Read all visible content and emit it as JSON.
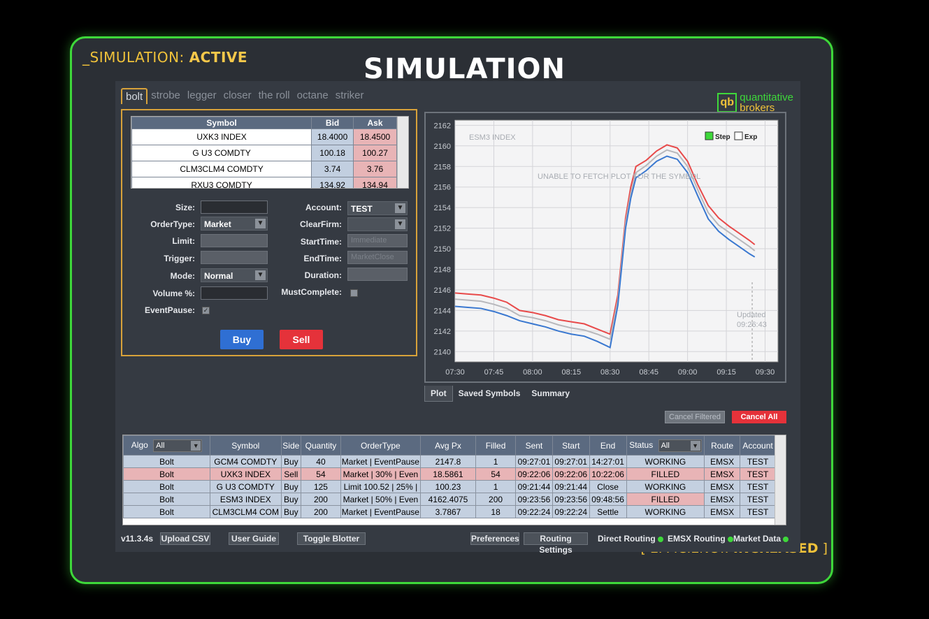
{
  "overlay": {
    "sim_status_prefix": "_SIMULATION: ",
    "sim_status_value": "ACTIVE",
    "title": "SIMULATION",
    "efficiency_prefix": "[ EFFICIENCY: ",
    "efficiency_value": "INCREASED",
    "efficiency_suffix": " ]"
  },
  "tabs": [
    "bolt",
    "strobe",
    "legger",
    "closer",
    "the roll",
    "octane",
    "striker"
  ],
  "logo": {
    "mark": "qb",
    "line1": "quantitative",
    "line2": "brokers"
  },
  "quotes": {
    "headers": [
      "Symbol",
      "Bid",
      "Ask"
    ],
    "rows": [
      {
        "symbol": "UXK3 INDEX",
        "bid": "18.4000",
        "ask": "18.4500"
      },
      {
        "symbol": "G U3 COMDTY",
        "bid": "100.18",
        "ask": "100.27"
      },
      {
        "symbol": "CLM3CLM4 COMDTY",
        "bid": "3.74",
        "ask": "3.76"
      },
      {
        "symbol": "RXU3 COMDTY",
        "bid": "134.92",
        "ask": "134.94"
      }
    ]
  },
  "form": {
    "size_label": "Size:",
    "ordertype_label": "OrderType:",
    "ordertype_value": "Market",
    "limit_label": "Limit:",
    "trigger_label": "Trigger:",
    "mode_label": "Mode:",
    "mode_value": "Normal",
    "volume_label": "Volume %:",
    "eventpause_label": "EventPause:",
    "account_label": "Account:",
    "account_value": "TEST",
    "clearfirm_label": "ClearFirm:",
    "starttime_label": "StartTime:",
    "starttime_placeholder": "Immediate",
    "endtime_label": "EndTime:",
    "endtime_placeholder": "MarketClose",
    "duration_label": "Duration:",
    "mustcomplete_label": "MustComplete:",
    "buy_label": "Buy",
    "sell_label": "Sell"
  },
  "chart_data": {
    "type": "line",
    "title": "ESM3 INDEX",
    "annotation": "UNABLE TO FETCH PLOT FOR THE SYMBOL",
    "updated_label": "Updated",
    "updated_time": "09:26:43",
    "legend": {
      "step": "Step",
      "exp": "Exp"
    },
    "xlabel": "",
    "ylabel": "",
    "x_ticks": [
      "07:30",
      "07:45",
      "08:00",
      "08:15",
      "08:30",
      "08:45",
      "09:00",
      "09:15",
      "09:30"
    ],
    "y_ticks": [
      2140,
      2142,
      2144,
      2146,
      2148,
      2150,
      2152,
      2154,
      2156,
      2158,
      2160,
      2162
    ],
    "ylim": [
      2139,
      2162.5
    ],
    "xlim_minutes": [
      450,
      575
    ],
    "x": [
      450,
      455,
      460,
      465,
      470,
      475,
      480,
      485,
      490,
      495,
      500,
      505,
      510,
      513,
      516,
      518,
      520,
      524,
      528,
      532,
      536,
      540,
      544,
      548,
      552,
      556,
      560,
      564,
      566
    ],
    "series": [
      {
        "color": "#e84a4a",
        "values": [
          2145.7,
          2145.6,
          2145.5,
          2145.2,
          2144.8,
          2144.0,
          2143.8,
          2143.5,
          2143.1,
          2142.9,
          2142.7,
          2142.2,
          2141.7,
          2145.5,
          2153.0,
          2156.0,
          2158.0,
          2158.6,
          2159.5,
          2160.1,
          2159.8,
          2158.5,
          2156.2,
          2154.2,
          2153.0,
          2152.2,
          2151.5,
          2150.8,
          2150.4
        ]
      },
      {
        "color": "#b8b8bc",
        "values": [
          2145.1,
          2145.0,
          2144.9,
          2144.6,
          2144.2,
          2143.5,
          2143.3,
          2143.0,
          2142.6,
          2142.3,
          2142.1,
          2141.7,
          2141.2,
          2145.0,
          2152.5,
          2155.4,
          2157.4,
          2158.1,
          2159.0,
          2159.6,
          2159.3,
          2158.0,
          2155.7,
          2153.5,
          2152.3,
          2151.6,
          2150.9,
          2150.2,
          2149.8
        ]
      },
      {
        "color": "#3a78d0",
        "values": [
          2144.4,
          2144.3,
          2144.2,
          2143.9,
          2143.5,
          2143.0,
          2142.7,
          2142.4,
          2142.0,
          2141.7,
          2141.5,
          2141.0,
          2140.4,
          2144.5,
          2152.0,
          2154.9,
          2156.9,
          2157.6,
          2158.5,
          2159.0,
          2158.7,
          2157.4,
          2155.1,
          2152.9,
          2151.7,
          2150.9,
          2150.2,
          2149.5,
          2149.2
        ]
      }
    ]
  },
  "chart_tabs": [
    "Plot",
    "Saved Symbols",
    "Summary"
  ],
  "actions": {
    "cancel_filtered": "Cancel Filtered",
    "cancel_all": "Cancel All"
  },
  "blotter": {
    "headers": [
      "Algo",
      "Symbol",
      "Side",
      "Quantity",
      "OrderType",
      "Avg Px",
      "Filled",
      "Sent",
      "Start",
      "End",
      "Status",
      "Route",
      "Account"
    ],
    "algo_filter": "All",
    "status_filter": "All",
    "rows": [
      [
        "Bolt",
        "GCM4 COMDTY",
        "Buy",
        "40",
        "Market | EventPause",
        "2147.8",
        "1",
        "09:27:01",
        "09:27:01",
        "14:27:01",
        "WORKING",
        "EMSX",
        "TEST"
      ],
      [
        "Bolt",
        "UXK3 INDEX",
        "Sell",
        "54",
        "Market | 30% | Even",
        "18.5861",
        "54",
        "09:22:06",
        "09:22:06",
        "10:22:06",
        "FILLED",
        "EMSX",
        "TEST"
      ],
      [
        "Bolt",
        "G U3 COMDTY",
        "Buy",
        "125",
        "Limit 100.52 | 25% |",
        "100.23",
        "1",
        "09:21:44",
        "09:21:44",
        "Close",
        "WORKING",
        "EMSX",
        "TEST"
      ],
      [
        "Bolt",
        "ESM3 INDEX",
        "Buy",
        "200",
        "Market | 50% | Even",
        "4162.4075",
        "200",
        "09:23:56",
        "09:23:56",
        "09:48:56",
        "FILLED",
        "EMSX",
        "TEST"
      ],
      [
        "Bolt",
        "CLM3CLM4 COM",
        "Buy",
        "200",
        "Market | EventPause",
        "3.7867",
        "18",
        "09:22:24",
        "09:22:24",
        "Settle",
        "WORKING",
        "EMSX",
        "TEST"
      ]
    ]
  },
  "footer": {
    "version": "v11.3.4s",
    "upload_csv": "Upload CSV",
    "user_guide": "User Guide",
    "toggle_blotter": "Toggle Blotter",
    "preferences": "Preferences",
    "routing_settings": "Routing Settings",
    "direct_routing": "Direct Routing",
    "emsx_routing": "EMSX Routing",
    "market_data": "Market Data"
  },
  "colors": {
    "accent_green": "#3ed83a",
    "accent_gold": "#f0c23a",
    "buy": "#2f6fd3",
    "sell": "#e5323a"
  }
}
